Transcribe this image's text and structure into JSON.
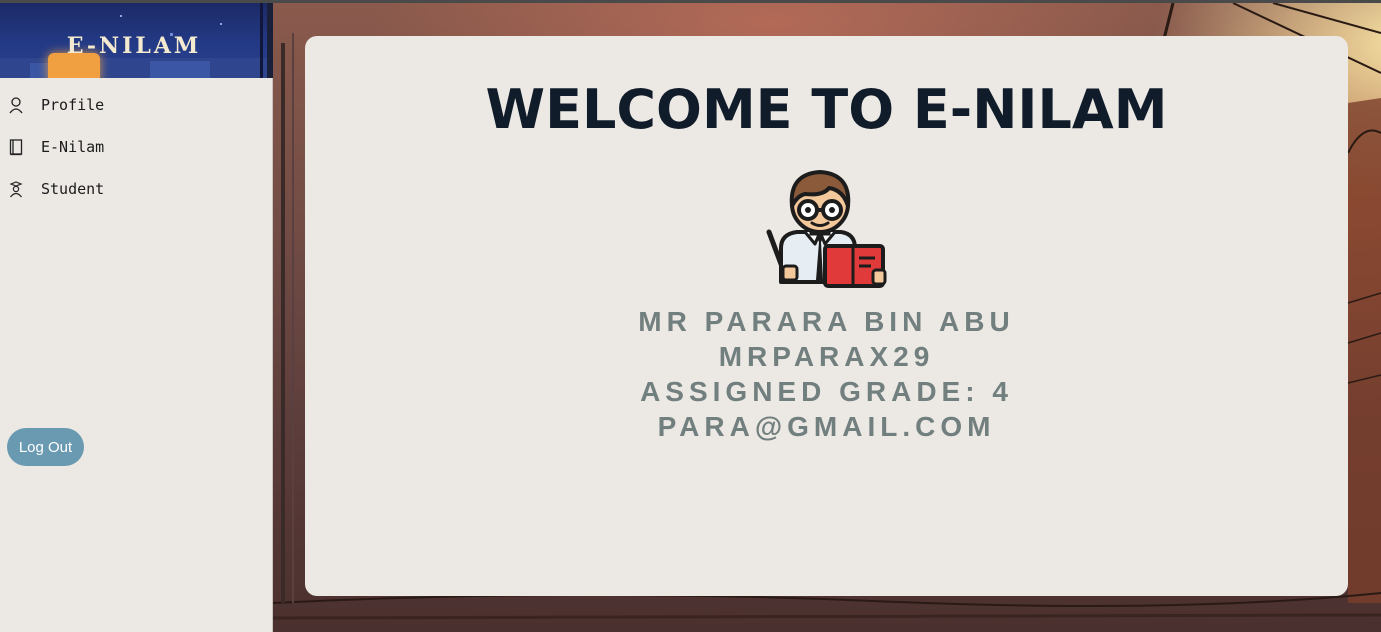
{
  "sidebar": {
    "brand": "E-NILAM",
    "items": [
      {
        "label": "Profile",
        "icon": "user-icon"
      },
      {
        "label": "E-Nilam",
        "icon": "book-icon"
      },
      {
        "label": "Student",
        "icon": "student-icon"
      }
    ],
    "logout_label": "Log Out"
  },
  "main": {
    "title": "WELCOME TO E-NILAM",
    "avatar_icon": "teacher-avatar-icon",
    "profile": {
      "name": "MR PARARA BIN ABU",
      "username": "MRPARAX29",
      "grade": "ASSIGNED GRADE: 4",
      "email": "PARA@GMAIL.COM"
    }
  },
  "colors": {
    "sidebar_bg": "#ece8e4",
    "card_bg": "#ece8e4",
    "title": "#101c2a",
    "info_text": "#727f7f",
    "logout_bg": "#6a9ab2",
    "banner_bg": "#233a86"
  }
}
